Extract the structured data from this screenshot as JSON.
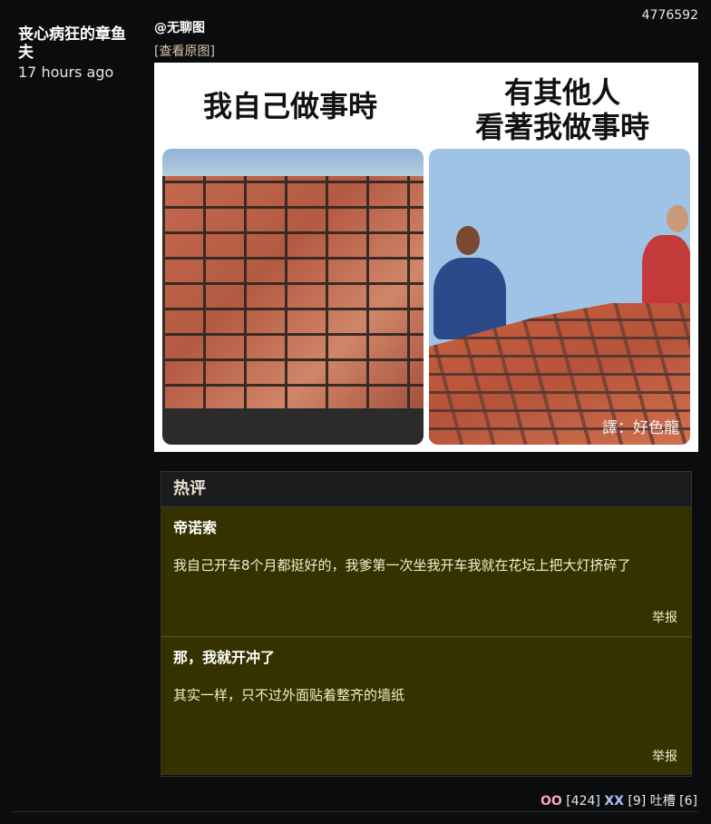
{
  "post": {
    "id": "4776592",
    "author": "丧心病狂的章鱼夫",
    "time": "17 hours ago",
    "mention": "@无聊图",
    "view_original": "[查看原图]"
  },
  "meme": {
    "caption_left": "我自己做事時",
    "caption_right_line1": "有其他人",
    "caption_right_line2": "看著我做事時",
    "credit": "譯：好色龍"
  },
  "hot_comments": {
    "title": "热评",
    "items": [
      {
        "author": "帝诺索",
        "text": "我自己开车8个月都挺好的，我爹第一次坐我开车我就在花坛上把大灯挤碎了",
        "report": "举报"
      },
      {
        "author": "那，我就开冲了",
        "text": "其实一样，只不过外面贴着整齐的墙纸",
        "report": "举报"
      }
    ]
  },
  "votes": {
    "oo_label": "OO",
    "oo_count": "[424]",
    "xx_label": "XX",
    "xx_count": "[9]",
    "tucao_label": "吐槽",
    "tucao_count": "[6]"
  }
}
